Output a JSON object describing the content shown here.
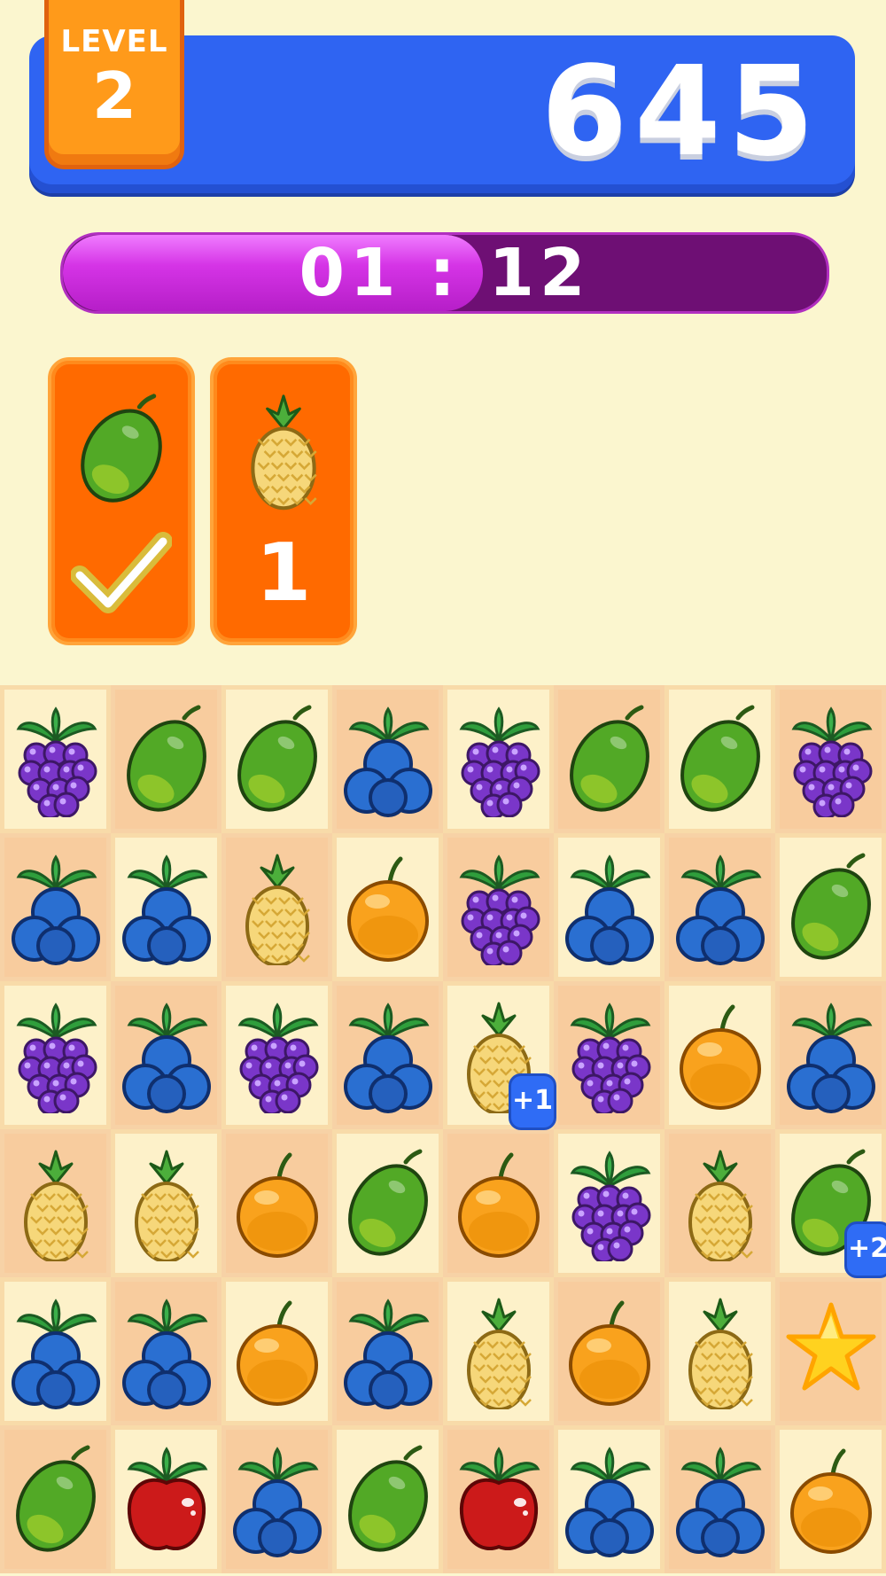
{
  "hud": {
    "level_label": "LEVEL",
    "level_number": "2",
    "score": "645",
    "timer": "01 : 12",
    "timer_progress": 0.55
  },
  "goals": [
    {
      "fruit": "mango",
      "status": "complete"
    },
    {
      "fruit": "pineapple",
      "remaining": "1"
    }
  ],
  "board": {
    "columns": 8,
    "rows": 6,
    "tiles": [
      [
        "grape",
        "mango",
        "mango",
        "blueberry",
        "grape",
        "mango",
        "mango",
        "grape"
      ],
      [
        "blueberry",
        "blueberry",
        "pineapple",
        "orange",
        "grape",
        "blueberry",
        "blueberry",
        "mango"
      ],
      [
        "grape",
        "blueberry",
        "grape",
        "blueberry",
        "pineapple",
        "grape",
        "orange",
        "blueberry"
      ],
      [
        "pineapple",
        "pineapple",
        "orange",
        "mango",
        "orange",
        "grape",
        "pineapple",
        "mango"
      ],
      [
        "blueberry",
        "blueberry",
        "orange",
        "blueberry",
        "pineapple",
        "orange",
        "pineapple",
        "star"
      ],
      [
        "mango",
        "apple",
        "blueberry",
        "mango",
        "apple",
        "blueberry",
        "blueberry",
        "orange"
      ]
    ],
    "bonus_labels": [
      "+1",
      "+2"
    ]
  },
  "colors": {
    "background": "#fbf6cf",
    "score_bar": "#2f64f2",
    "level_badge": "#ff9a1a",
    "timer_fill": "#d534e6",
    "timer_track": "#6e0f74",
    "goal_card": "#ff6a00"
  }
}
